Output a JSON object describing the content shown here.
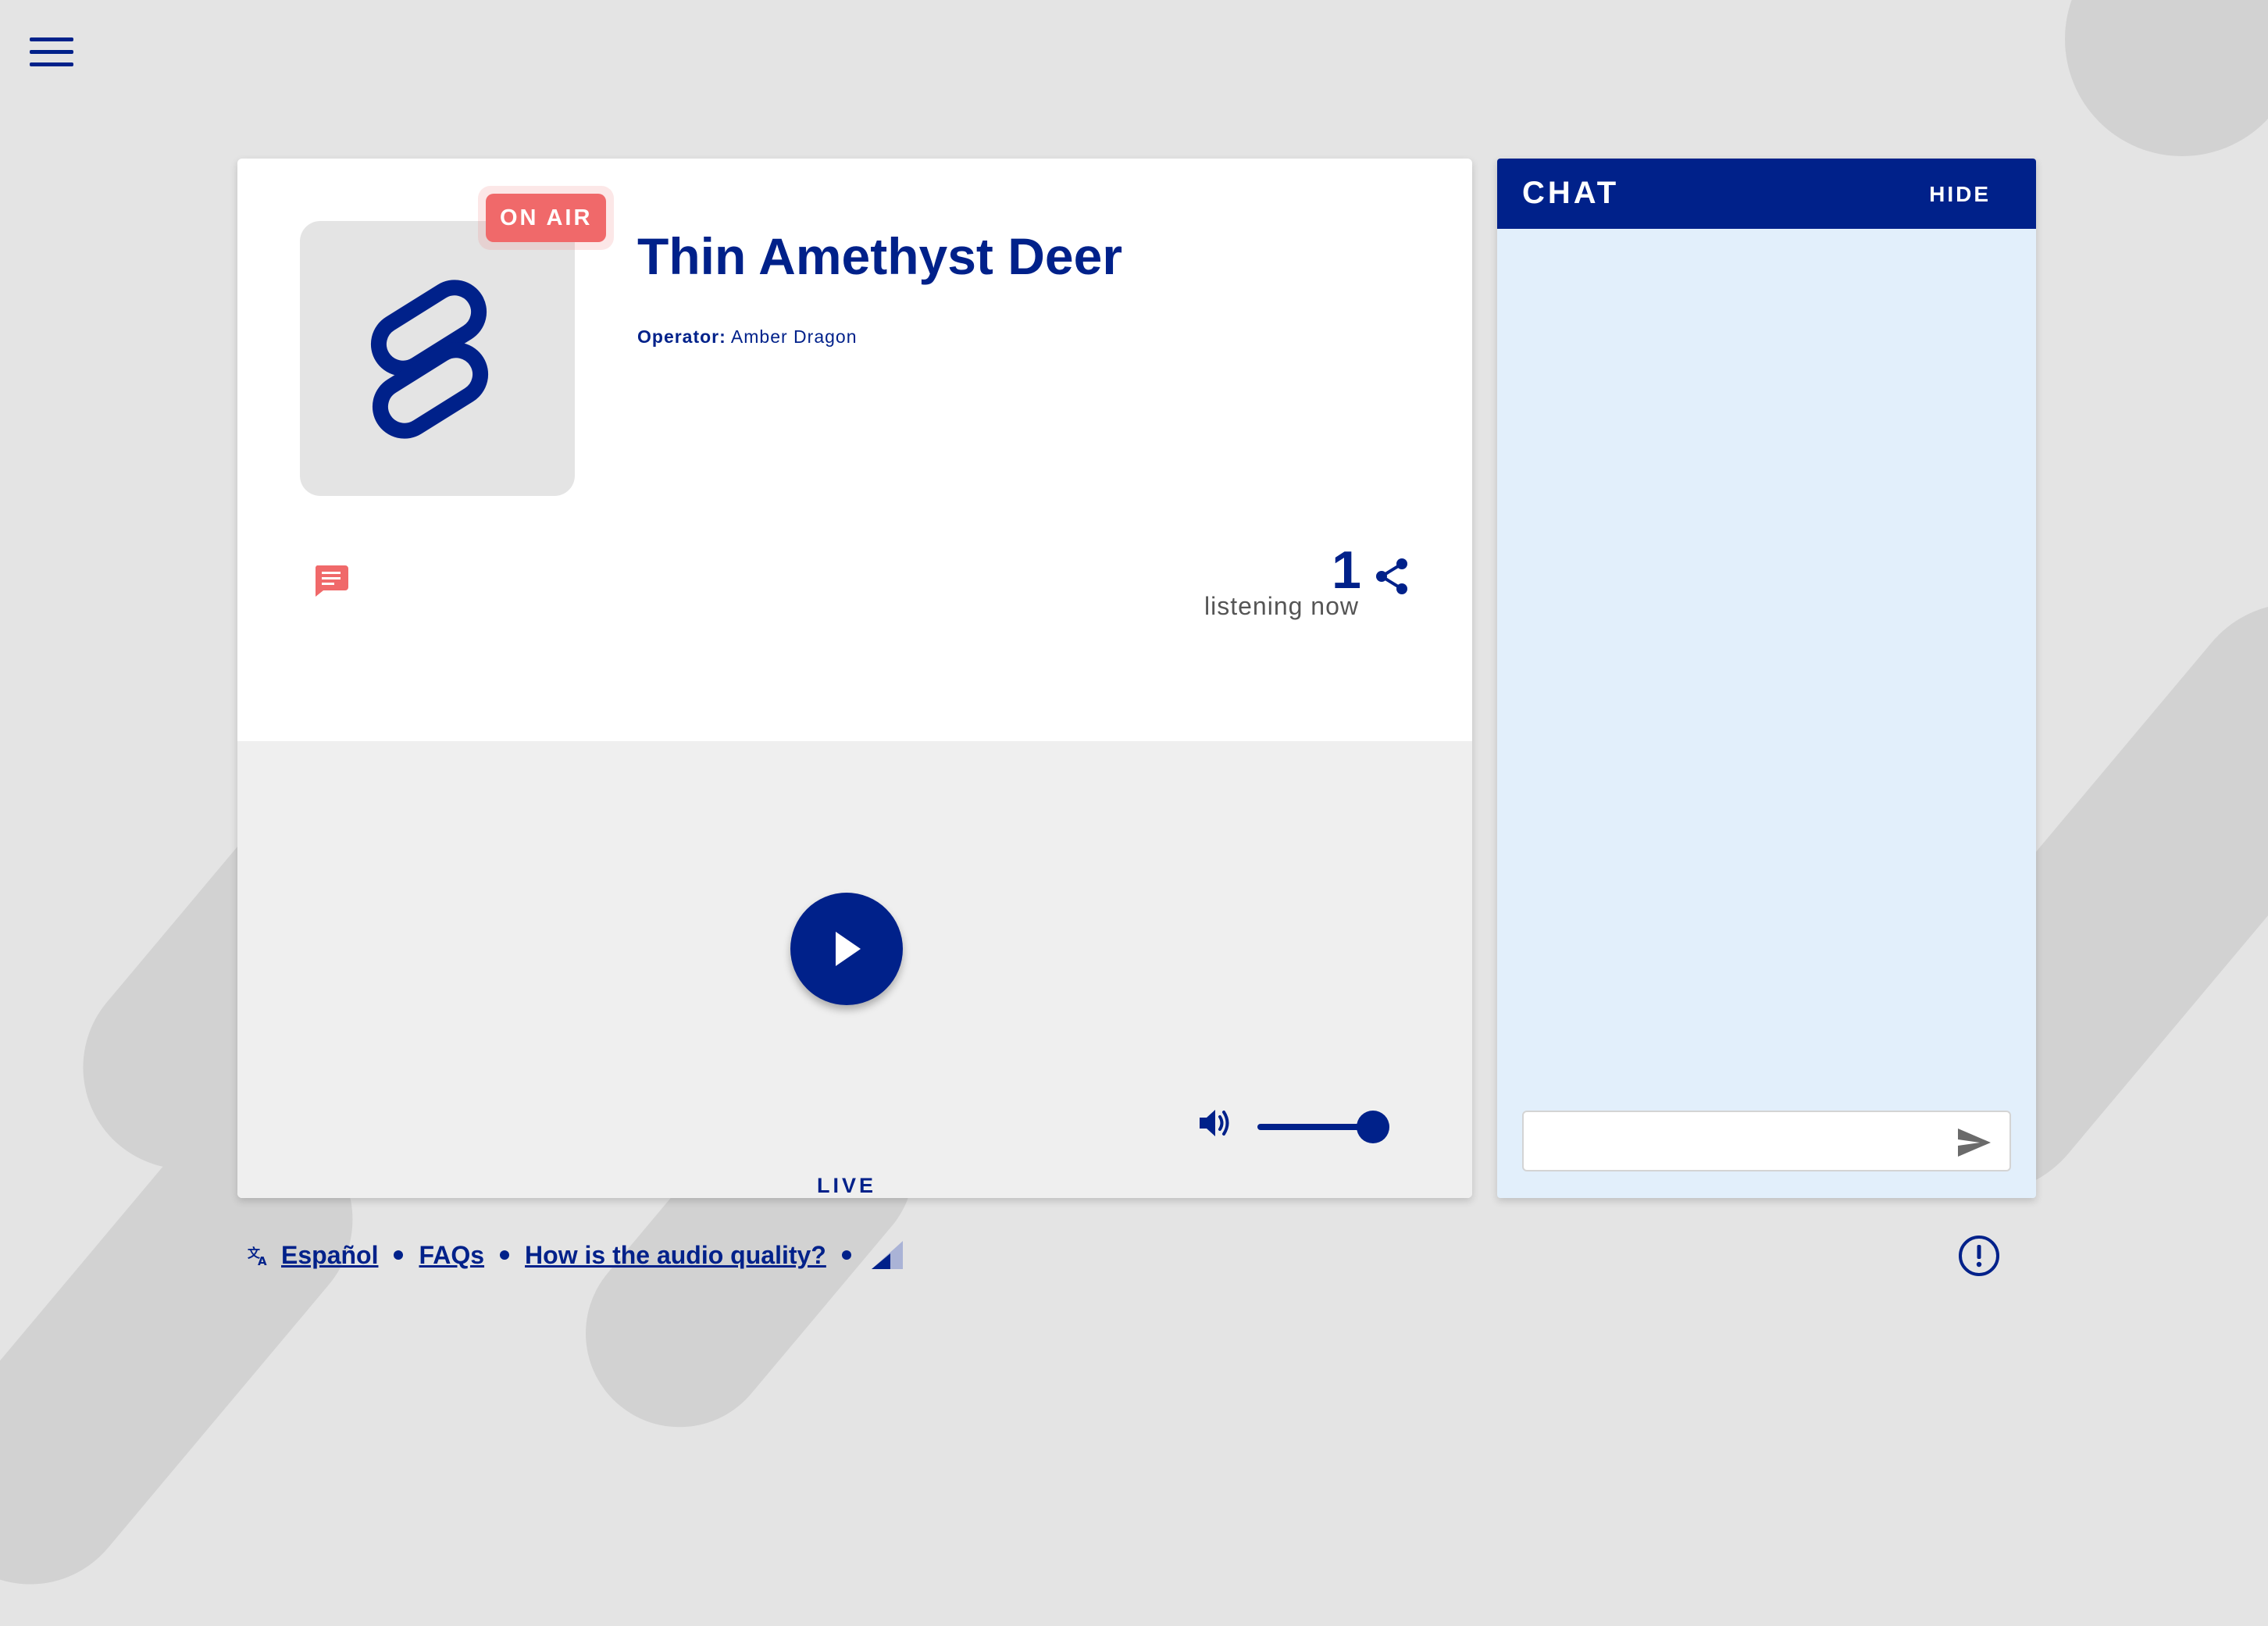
{
  "app": {
    "brand_color": "#00218a",
    "accent_color": "#f0696a",
    "background_color": "#e4e4e4",
    "chat_background": "#e2effb"
  },
  "header": {
    "menu_icon": "hamburger-menu-icon"
  },
  "station": {
    "status_badge": "ON AIR",
    "title": "Thin Amethyst Deer",
    "operator_label": "Operator:",
    "operator_name": "Amber Dragon",
    "logo_icon": "chain-link-logo"
  },
  "listeners": {
    "count": "1",
    "label": "listening now",
    "share_icon": "share-icon"
  },
  "player": {
    "play_icon": "play-icon",
    "live_label": "LIVE",
    "volume_icon": "volume-icon",
    "volume_level": 1.0
  },
  "chat": {
    "title": "CHAT",
    "hide_label": "HIDE",
    "input_value": "",
    "input_placeholder": "",
    "send_icon": "send-icon"
  },
  "footer": {
    "links": [
      "Español",
      "FAQs",
      "How is the audio quality?"
    ],
    "translate_icon": "translate-icon",
    "signal_icon": "signal-icon",
    "alert_icon": "alert-icon"
  }
}
